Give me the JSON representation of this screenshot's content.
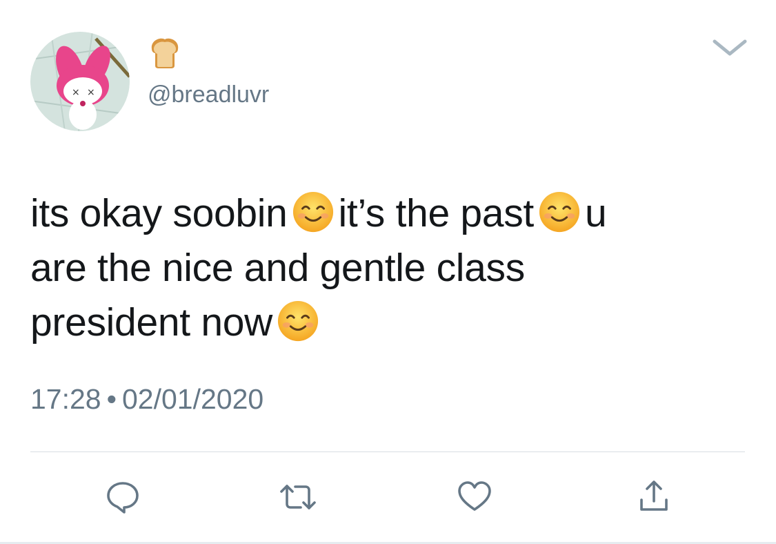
{
  "tweet": {
    "display_name_emoji": "bread-emoji",
    "handle": "@breadluvr",
    "text_lines": [
      [
        "its okay soobin",
        "it’s the past",
        "u"
      ],
      [
        "are the nice and gentle class"
      ],
      [
        "president now"
      ]
    ],
    "line1_part1": "its okay soobin",
    "line1_part2": "it’s the past",
    "line1_part3": "u",
    "line2": "are the nice and gentle class",
    "line3": "president now",
    "time": "17:28",
    "separator": "•",
    "date": "02/01/2020"
  },
  "icons": {
    "reply": "reply-icon",
    "retweet": "retweet-icon",
    "like": "heart-icon",
    "share": "share-icon",
    "more": "chevron-down-icon",
    "emoji": "smiling-face-emoji"
  },
  "colors": {
    "text": "#14171a",
    "secondary": "#657786",
    "icon": "#657786",
    "divider": "#d8dee3",
    "avatar_bg": "#c9dcd6",
    "avatar_character": "#e8458b"
  }
}
